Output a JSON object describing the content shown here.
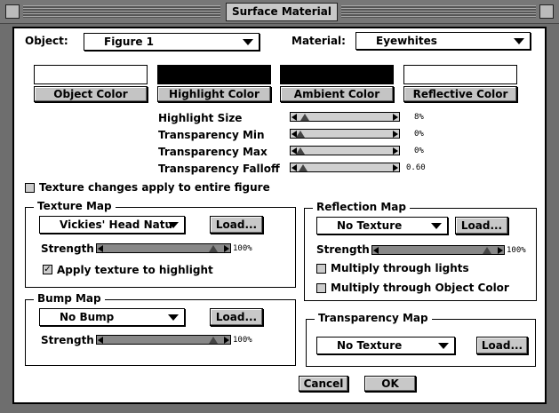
{
  "window": {
    "title": "Surface Material"
  },
  "object": {
    "label": "Object:",
    "value": "Figure 1"
  },
  "material": {
    "label": "Material:",
    "value": "Eyewhites"
  },
  "colors": {
    "object": {
      "label": "Object Color",
      "swatch": "#ffffff"
    },
    "highlight": {
      "label": "Highlight Color",
      "swatch": "#000000"
    },
    "ambient": {
      "label": "Ambient Color",
      "swatch": "#000000"
    },
    "reflective": {
      "label": "Reflective Color",
      "swatch": "#ffffff"
    }
  },
  "sliders": {
    "highlight_size": {
      "label": "Highlight Size",
      "value": "8%",
      "level": 0.08
    },
    "transparency_min": {
      "label": "Transparency Min",
      "value": "0%",
      "level": 0
    },
    "transparency_max": {
      "label": "Transparency Max",
      "value": "0%",
      "level": 0
    },
    "transparency_falloff": {
      "label": "Transparency Falloff",
      "value": "0.60",
      "level": 0.06
    }
  },
  "texture_entire": {
    "label": "Texture changes apply to entire figure",
    "checked": false
  },
  "texture_map": {
    "title": "Texture Map",
    "value": "Vickies' Head Natu",
    "load": "Load...",
    "strength_label": "Strength",
    "strength": "100%",
    "strength_level": 1.0,
    "apply_highlight": {
      "label": "Apply texture to highlight",
      "checked": true
    }
  },
  "bump_map": {
    "title": "Bump Map",
    "value": "No Bump",
    "load": "Load...",
    "strength_label": "Strength",
    "strength": "100%",
    "strength_level": 1.0
  },
  "reflection_map": {
    "title": "Reflection Map",
    "value": "No Texture",
    "load": "Load...",
    "strength_label": "Strength",
    "strength": "100%",
    "strength_level": 1.0,
    "multiply_lights": {
      "label": "Multiply through lights",
      "checked": false
    },
    "multiply_object": {
      "label": "Multiply through Object Color",
      "checked": false
    }
  },
  "transparency_map": {
    "title": "Transparency Map",
    "value": "No Texture",
    "load": "Load..."
  },
  "buttons": {
    "cancel": "Cancel",
    "ok": "OK"
  }
}
